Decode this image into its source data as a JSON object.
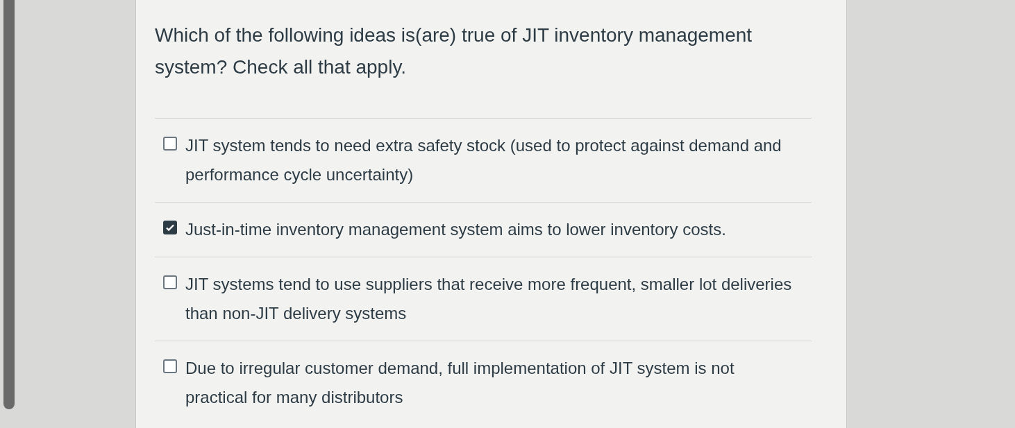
{
  "question": "Which of the following ideas is(are) true of JIT inventory management system? Check all that apply.",
  "options": [
    {
      "label": "JIT system tends to need extra safety stock (used to protect against demand and performance cycle uncertainty)",
      "checked": false
    },
    {
      "label": "Just-in-time inventory management system aims to lower inventory costs.",
      "checked": true
    },
    {
      "label": "JIT systems tend to use suppliers that receive more frequent, smaller lot deliveries than non-JIT delivery systems",
      "checked": false
    },
    {
      "label": "Due to irregular customer demand, full implementation of JIT system is not practical for many distributors",
      "checked": false
    }
  ]
}
